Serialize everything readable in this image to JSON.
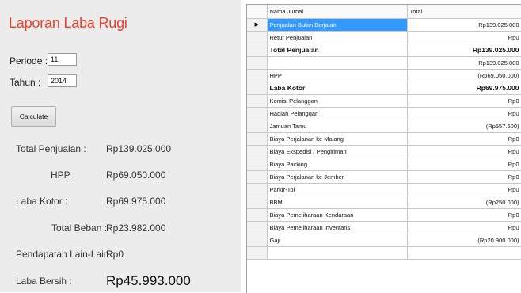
{
  "form": {
    "title": "Laporan Laba Rugi",
    "periode_label": "Periode :",
    "periode_value": "11",
    "tahun_label": "Tahun :",
    "tahun_value": "2014",
    "calculate_label": "Calculate"
  },
  "summary": {
    "total_penjualan_label": "Total Penjualan :",
    "total_penjualan_value": "Rp139.025.000",
    "hpp_label": "HPP :",
    "hpp_value": "Rp69.050.000",
    "laba_kotor_label": "Laba Kotor :",
    "laba_kotor_value": "Rp69.975.000",
    "total_beban_label": "Total Beban :",
    "total_beban_value": "Rp23.982.000",
    "pendapatan_lain_label": "Pendapatan Lain-Lain :",
    "pendapatan_lain_value": "Rp0",
    "laba_bersih_label": "Laba Bersih :",
    "laba_bersih_value": "Rp45.993.000"
  },
  "grid": {
    "col_nama": "Nama Jurnal",
    "col_total": "Total",
    "current_row_glyph": "▶",
    "rows": [
      {
        "nama": "Penjualan Bulan Berjalan",
        "total": "Rp139.025.000"
      },
      {
        "nama": "Retur Penjualan",
        "total": "Rp0"
      },
      {
        "nama": "Total Penjualan",
        "total": "Rp139.025.000"
      },
      {
        "nama": "",
        "total": "Rp139.025.000"
      },
      {
        "nama": "HPP",
        "total": "(Rp69.050.000)"
      },
      {
        "nama": "Laba Kotor",
        "total": "Rp69.975.000"
      },
      {
        "nama": "Komisi Pelanggan",
        "total": "Rp0"
      },
      {
        "nama": "Hadiah Pelanggan",
        "total": "Rp0"
      },
      {
        "nama": "Jamuan Tamu",
        "total": "(Rp557.500)"
      },
      {
        "nama": "Biaya Perjalanan ke Malang",
        "total": "Rp0"
      },
      {
        "nama": "Biaya Ekspedisi / Pengiriman",
        "total": "Rp0"
      },
      {
        "nama": "Biaya Packing",
        "total": "Rp0"
      },
      {
        "nama": "Biaya Perjalanan ke Jember",
        "total": "Rp0"
      },
      {
        "nama": "Parkir-Tol",
        "total": "Rp0"
      },
      {
        "nama": "BBM",
        "total": "(Rp250.000)"
      },
      {
        "nama": "Biaya Pemeliharaan Kendaraan",
        "total": "Rp0"
      },
      {
        "nama": "Biaya Pemeliharaan Inventaris",
        "total": "Rp0"
      },
      {
        "nama": "Gaji",
        "total": "(Rp20.900.000)"
      },
      {
        "nama": "",
        "total": ""
      }
    ]
  }
}
